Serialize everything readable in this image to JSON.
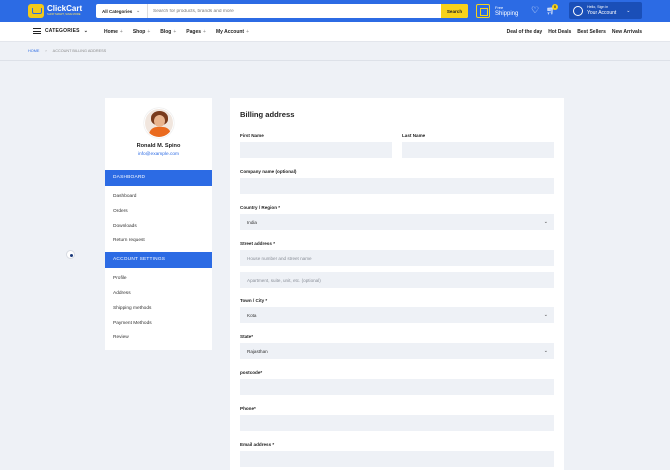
{
  "header": {
    "logo_name": "ClickCart",
    "logo_tagline": "SHOP SMART, SAVE MORE",
    "search_category": "All Categories",
    "search_placeholder": "Search for products, brands and more",
    "search_button": "Search",
    "shipping_line1": "Free",
    "shipping_line2": "Shipping",
    "cart_count": "0",
    "account_line1": "Hello, Sign in",
    "account_line2": "Your Account",
    "colors": {
      "primary": "#2c6be4",
      "accent": "#f7d21a"
    }
  },
  "nav": {
    "categories": "CATEGORIES",
    "menu": [
      {
        "label": "Home",
        "plus": "+"
      },
      {
        "label": "Shop",
        "plus": "+"
      },
      {
        "label": "Blog",
        "plus": "+"
      },
      {
        "label": "Pages",
        "plus": "+"
      },
      {
        "label": "My Account",
        "plus": "+"
      }
    ],
    "right_links": [
      "Deal of the day",
      "Hot Deals",
      "Best Sellers",
      "New Arrivals"
    ]
  },
  "breadcrumb": {
    "home": "HOME",
    "separator": "›",
    "current": "ACCOUNT BILLING ADDRESS"
  },
  "sidebar": {
    "user_name": "Ronald M. Spino",
    "user_email": "info@example.com",
    "dashboard_header": "DASHBOARD",
    "dashboard_items": [
      "Dashboard",
      "Orders",
      "Downloads",
      "Return request"
    ],
    "settings_header": "ACCOUNT SETTINGS",
    "settings_items": [
      "Profile",
      "Address",
      "Shipping methods",
      "Payment Methods",
      "Review"
    ]
  },
  "form": {
    "title": "Billing address",
    "first_name_label": "First Name",
    "last_name_label": "Last Name",
    "company_label": "Company name (optional)",
    "country_label": "Country / Region *",
    "country_value": "India",
    "street_label": "Street address *",
    "street_placeholder": "House number and street name",
    "street2_placeholder": "Apartment, suite, unit, etc. (optional)",
    "town_label": "Town / City *",
    "town_value": "Kota",
    "state_label": "State*",
    "state_value": "Rajasthan",
    "postcode_label": "postcode*",
    "phone_label": "Phone*",
    "email_label": "Email address *"
  }
}
